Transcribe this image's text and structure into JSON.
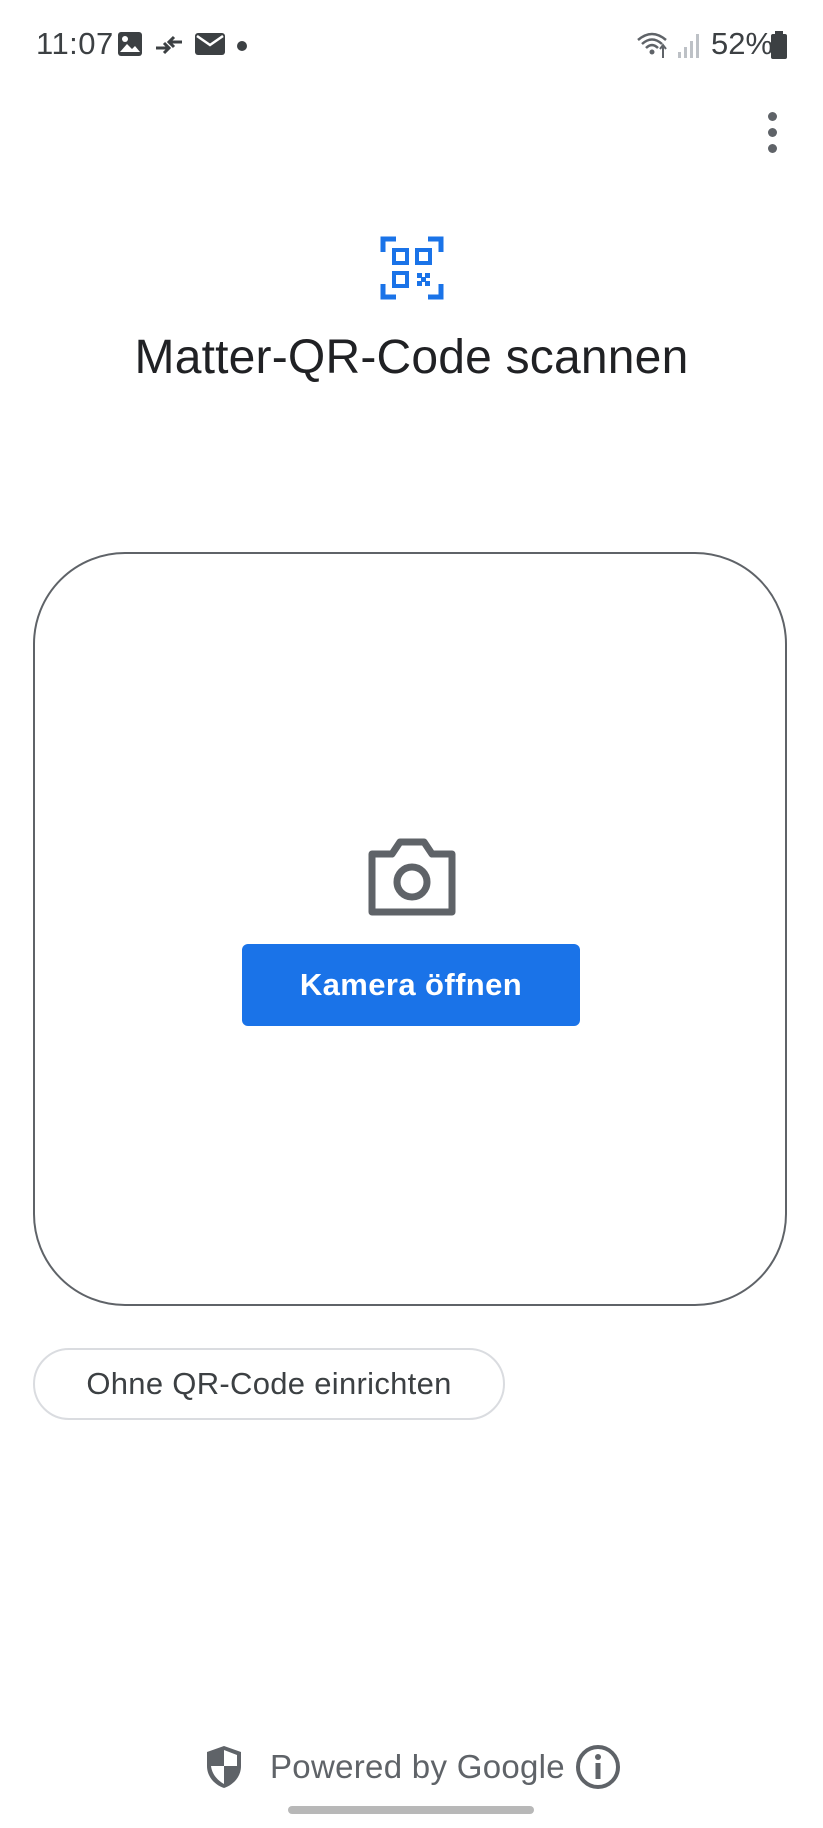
{
  "status_bar": {
    "time": "11:07",
    "battery": "52%",
    "icons": [
      "image-icon",
      "transfer-icon",
      "mail-icon",
      "dot-icon",
      "wifi-icon",
      "signal-icon",
      "battery-icon"
    ]
  },
  "menu": {
    "icon": "more-vert-icon"
  },
  "header": {
    "icon": "qr-code-scanner-icon",
    "title": "Matter-QR-Code scannen"
  },
  "scanner": {
    "icon": "camera-icon",
    "open_camera_label": "Kamera öffnen"
  },
  "secondary_action": {
    "label": "Ohne QR-Code einrichten"
  },
  "footer": {
    "shield_icon": "shield-icon",
    "powered_text": "Powered by Google",
    "info_icon": "info-icon"
  },
  "colors": {
    "accent": "#1a73e8",
    "text_primary": "#202124",
    "text_secondary": "#5f6368",
    "border": "#5f6368"
  }
}
